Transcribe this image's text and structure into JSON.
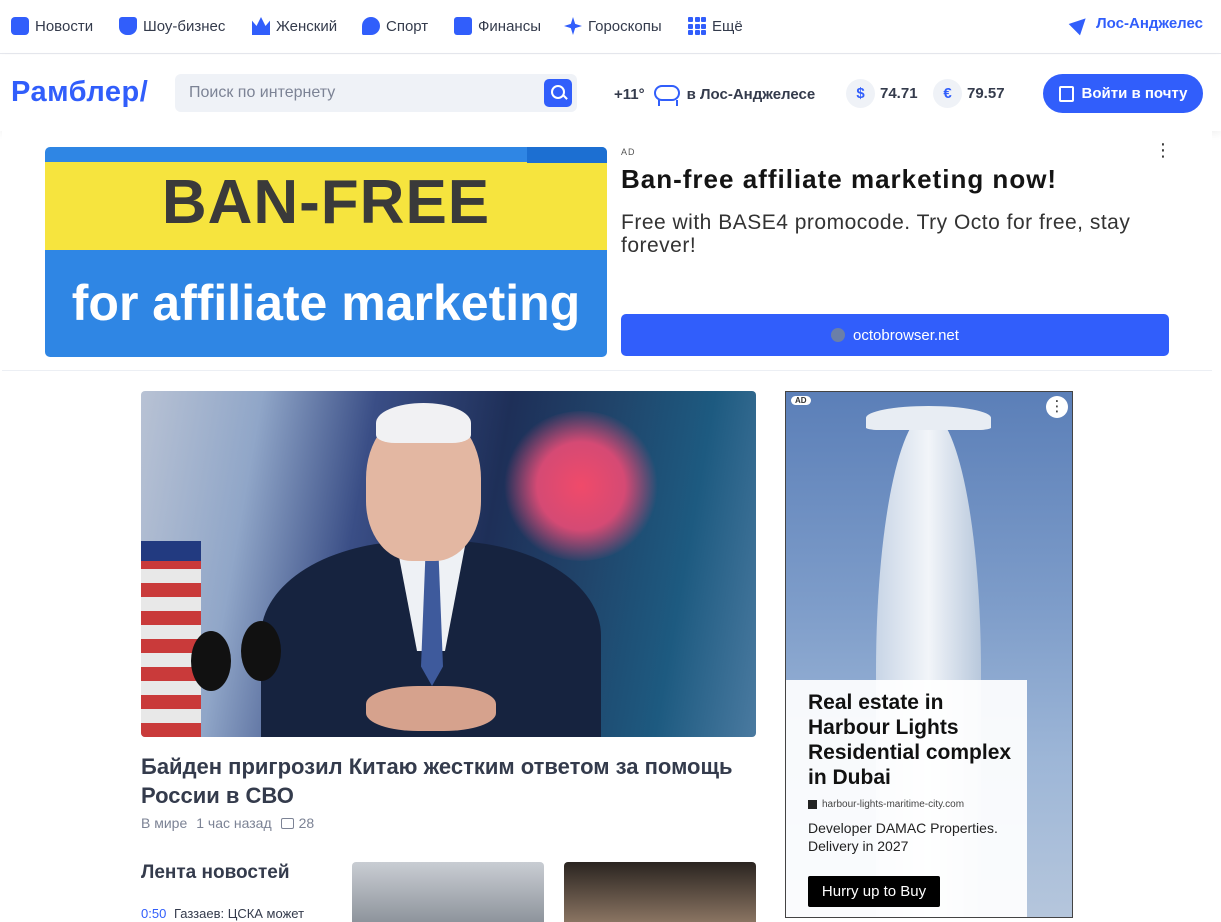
{
  "topnav": {
    "items": [
      {
        "label": "Новости"
      },
      {
        "label": "Шоу-бизнес"
      },
      {
        "label": "Женский"
      },
      {
        "label": "Спорт"
      },
      {
        "label": "Финансы"
      },
      {
        "label": "Гороскопы"
      },
      {
        "label": "Ещё"
      }
    ],
    "location": "Лос-Анджелес"
  },
  "header": {
    "logo": "Рамблер/",
    "search_placeholder": "Поиск по интернету",
    "weather": {
      "temp": "+11°",
      "city": "в Лос-Анджелесе"
    },
    "rates": [
      {
        "symbol": "$",
        "value": "74.71"
      },
      {
        "symbol": "€",
        "value": "79.57"
      }
    ],
    "mail_button": "Войти в почту"
  },
  "top_ad": {
    "banner_line1": "BAN-FREE",
    "banner_line2": "for affiliate marketing",
    "label": "AD",
    "title": "Ban-free affiliate marketing now!",
    "description": "Free with BASE4 promocode. Try Octo for free, stay forever!",
    "button": "octobrowser.net",
    "menu": "⋮"
  },
  "main_story": {
    "headline": "Байден пригрозил Китаю жестким ответом за помощь России в СВО",
    "category": "В мире",
    "time": "1 час назад",
    "comments": "28"
  },
  "feed": {
    "title": "Лента новостей",
    "first_item": {
      "time": "0:50",
      "text": "Газзаев: ЦСКА может"
    }
  },
  "side_ad": {
    "label": "AD",
    "menu": "⋮",
    "title": "Real estate in Harbour Lights Residential complex in Dubai",
    "url": "harbour-lights-maritime-city.com",
    "description": "Developer DAMAC Properties. Delivery in 2027",
    "button": "Hurry up to Buy"
  }
}
